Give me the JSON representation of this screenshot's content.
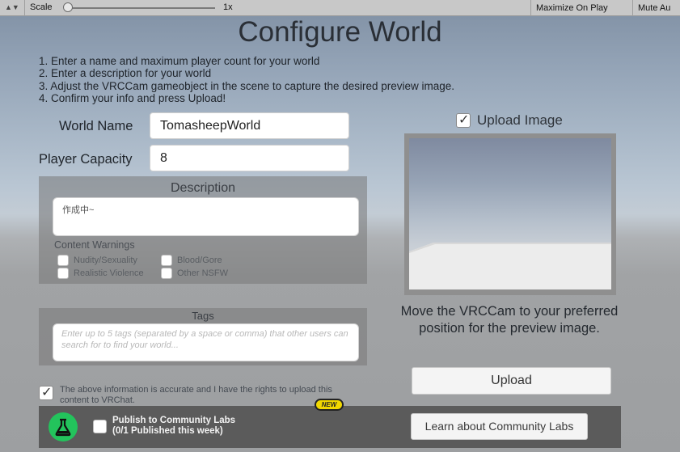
{
  "toolbar": {
    "scale_label": "Scale",
    "scale_value": "1x",
    "maximize_label": "Maximize On Play",
    "mute_label": "Mute Au"
  },
  "title": "Configure World",
  "instructions": [
    "1. Enter a name and maximum player count for your world",
    "2. Enter a description for your world",
    "3. Adjust the VRCCam gameobject in the scene to capture the desired preview image.",
    "4. Confirm your info and press Upload!"
  ],
  "form": {
    "world_name_label": "World Name",
    "world_name_value": "TomasheepWorld",
    "capacity_label": "Player Capacity",
    "capacity_value": "8"
  },
  "description": {
    "title": "Description",
    "value": "作成中~",
    "warnings_title": "Content Warnings",
    "warnings": [
      "Nudity/Sexuality",
      "Blood/Gore",
      "Realistic Violence",
      "Other NSFW"
    ]
  },
  "tags": {
    "title": "Tags",
    "placeholder": "Enter up to 5 tags (separated by a space or comma) that other users can search for to find your world..."
  },
  "upload_image": {
    "label": "Upload Image",
    "checked": true
  },
  "preview_hint": "Move the VRCCam to your preferred position for the preview image.",
  "rights": {
    "text": "The above information is accurate and I have the rights to upload this content to VRChat.",
    "checked": true
  },
  "upload_button": "Upload",
  "community": {
    "badge": "NEW",
    "publish_line1": "Publish to Community Labs",
    "publish_line2": "(0/1 Published this week)",
    "learn_button": "Learn about Community Labs"
  },
  "colors": {
    "lab_green": "#23c35c",
    "badge_yellow": "#f1d800"
  }
}
